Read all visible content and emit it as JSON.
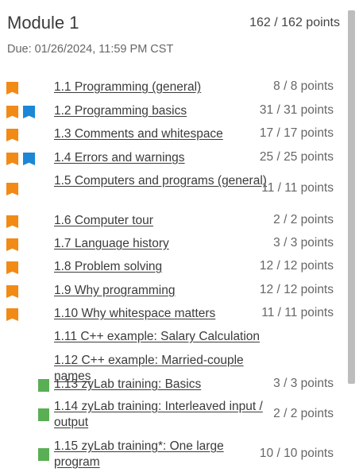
{
  "module": {
    "title": "Module 1",
    "points": "162 / 162 points",
    "due": "Due: 01/26/2024, 11:59 PM CST"
  },
  "sections": [
    {
      "label": "1.1 Programming (general)",
      "points": "8 / 8 points",
      "icons": [
        "orange"
      ]
    },
    {
      "label": "1.2 Programming basics",
      "points": "31 / 31 points",
      "icons": [
        "orange",
        "blue"
      ]
    },
    {
      "label": "1.3 Comments and whitespace",
      "points": "17 / 17 points",
      "icons": [
        "orange"
      ]
    },
    {
      "label": "1.4 Errors and warnings",
      "points": "25 / 25 points",
      "icons": [
        "orange",
        "blue"
      ]
    },
    {
      "label": "1.5 Computers and programs (general)",
      "points": "11 / 11 points",
      "icons": [
        "orange"
      ]
    },
    {
      "label": "1.6 Computer tour",
      "points": "2 / 2 points",
      "icons": [
        "orange"
      ]
    },
    {
      "label": "1.7 Language history",
      "points": "3 / 3 points",
      "icons": [
        "orange"
      ]
    },
    {
      "label": "1.8 Problem solving",
      "points": "12 / 12 points",
      "icons": [
        "orange"
      ]
    },
    {
      "label": "1.9 Why programming",
      "points": "12 / 12 points",
      "icons": [
        "orange"
      ]
    },
    {
      "label": "1.10 Why whitespace matters",
      "points": "11 / 11 points",
      "icons": [
        "orange"
      ]
    },
    {
      "label": "1.11 C++ example: Salary Calculation",
      "points": "",
      "icons": []
    },
    {
      "label": "1.12 C++ example: Married-couple names",
      "points": "",
      "icons": []
    },
    {
      "label": "1.13 zyLab training: Basics",
      "points": "3 / 3 points",
      "icons": [
        "green"
      ]
    },
    {
      "label": "1.14 zyLab training: Interleaved input / output",
      "points": "2 / 2 points",
      "icons": [
        "green"
      ]
    },
    {
      "label": "1.15 zyLab training*: One large program",
      "points": "10 / 10 points",
      "icons": [
        "green"
      ]
    }
  ]
}
